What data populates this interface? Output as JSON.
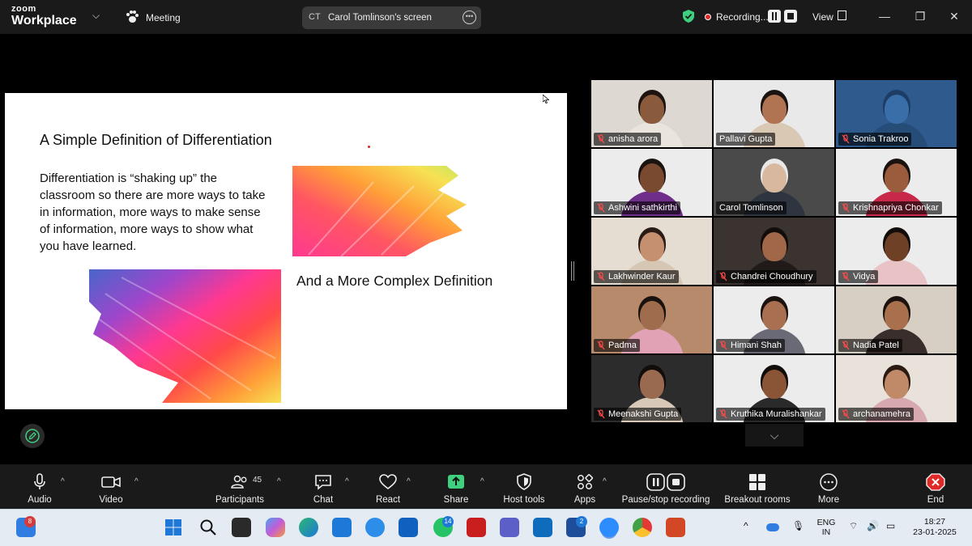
{
  "titlebar": {
    "brand_small": "zoom",
    "brand_big": "Workplace",
    "meeting_label": "Meeting",
    "share_initials": "CT",
    "share_title": "Carol Tomlinson's screen",
    "recording_label": "Recording...",
    "view_label": "View"
  },
  "slide": {
    "title": "A Simple Definition of Differentiation",
    "body": "Differentiation is “shaking up” the classroom so there are more ways to take in information, more ways to make sense of information, more ways to show what you have learned.",
    "subtitle": "And a More Complex Definition"
  },
  "participants": [
    {
      "name": "anisha arora",
      "muted": true,
      "bg": "#ddd8d2",
      "skin": "#8a5a3c",
      "shirt": "#e9e4dc",
      "hair": "#1d1410"
    },
    {
      "name": "Pallavi Gupta",
      "muted": false,
      "bg": "#e9e9e9",
      "skin": "#b07452",
      "shirt": "#d8c8b4",
      "hair": "#1a1310"
    },
    {
      "name": "Sonia Trakroo",
      "muted": true,
      "bg": "#2e5a8e",
      "skin": "#3a6ea8",
      "shirt": "#264c78",
      "hair": "#1d3d66"
    },
    {
      "name": "Ashwini sathkirthi",
      "muted": true,
      "bg": "#ececec",
      "skin": "#7a4a30",
      "shirt": "#6f2e8a",
      "hair": "#1b1410"
    },
    {
      "name": "Carol Tomlinson",
      "muted": false,
      "bg": "#4a4a4a",
      "skin": "#d9b8a0",
      "shirt": "#2f3540",
      "hair": "#e8e8e8",
      "active": true
    },
    {
      "name": "Krishnapriya Chonkar",
      "muted": true,
      "bg": "#ececec",
      "skin": "#9a5c3c",
      "shirt": "#c8284a",
      "hair": "#1a120e"
    },
    {
      "name": "Lakhwinder Kaur",
      "muted": true,
      "bg": "#e6ddd2",
      "skin": "#c49070",
      "shirt": "#d6c6b4",
      "hair": "#2a1c14"
    },
    {
      "name": "Chandrei Choudhury",
      "muted": true,
      "bg": "#3a3330",
      "skin": "#a06848",
      "shirt": "#201a18",
      "hair": "#120c0a"
    },
    {
      "name": "Vidya",
      "muted": true,
      "bg": "#ececec",
      "skin": "#6e4026",
      "shirt": "#e8c2c4",
      "hair": "#120c0a"
    },
    {
      "name": "Padma",
      "muted": true,
      "bg": "#b68a6a",
      "skin": "#a06c4e",
      "shirt": "#e2a2b6",
      "hair": "#1a120e"
    },
    {
      "name": "Himani Shah",
      "muted": true,
      "bg": "#ececec",
      "skin": "#a87050",
      "shirt": "#6a6a76",
      "hair": "#1a120e"
    },
    {
      "name": "Nadia Patel",
      "muted": true,
      "bg": "#d8cfc4",
      "skin": "#a8704c",
      "shirt": "#3a2e2c",
      "hair": "#1a120e"
    },
    {
      "name": "Meenakshi Gupta",
      "muted": true,
      "bg": "#2c2c2c",
      "skin": "#9a6a50",
      "shirt": "#d8c8b8",
      "hair": "#120c0a"
    },
    {
      "name": "Kruthika Muralishankar",
      "muted": true,
      "bg": "#ececec",
      "skin": "#8a5436",
      "shirt": "#2a2a2a",
      "hair": "#120c0a"
    },
    {
      "name": "archanamehra",
      "muted": true,
      "bg": "#e8e2da",
      "skin": "#c08a68",
      "shirt": "#d8a8b0",
      "hair": "#2a1a12"
    }
  ],
  "toolbar": {
    "audio": "Audio",
    "video": "Video",
    "participants": "Participants",
    "participant_count": "45",
    "chat": "Chat",
    "react": "React",
    "share": "Share",
    "host_tools": "Host tools",
    "apps": "Apps",
    "pause_recording": "Pause/stop recording",
    "breakout": "Breakout rooms",
    "more": "More",
    "end": "End"
  },
  "taskbar": {
    "widget_badge": "8",
    "whatsapp_badge": "14",
    "lync_badge": "2",
    "lang_top": "ENG",
    "lang_bottom": "IN",
    "time": "18:27",
    "date": "23-01-2025"
  },
  "colors": {
    "accent_green": "#3fd07f",
    "record_red": "#e02828",
    "end_red": "#e02828",
    "toolbar_bg": "#1a1a1a"
  }
}
